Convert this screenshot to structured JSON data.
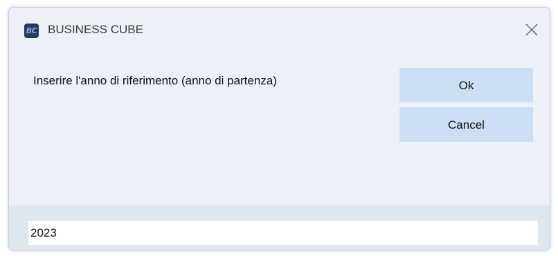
{
  "window": {
    "title": "BUSINESS CUBE",
    "app_icon_text": "BC",
    "close_icon": "close-icon"
  },
  "dialog": {
    "prompt": "Inserire l'anno di riferimento (anno di partenza)",
    "ok_label": "Ok",
    "cancel_label": "Cancel",
    "input_value": "2023"
  },
  "colors": {
    "window_bg": "#eef0f8",
    "button_bg": "#cddff5",
    "input_strip_bg": "#dde7f0"
  }
}
